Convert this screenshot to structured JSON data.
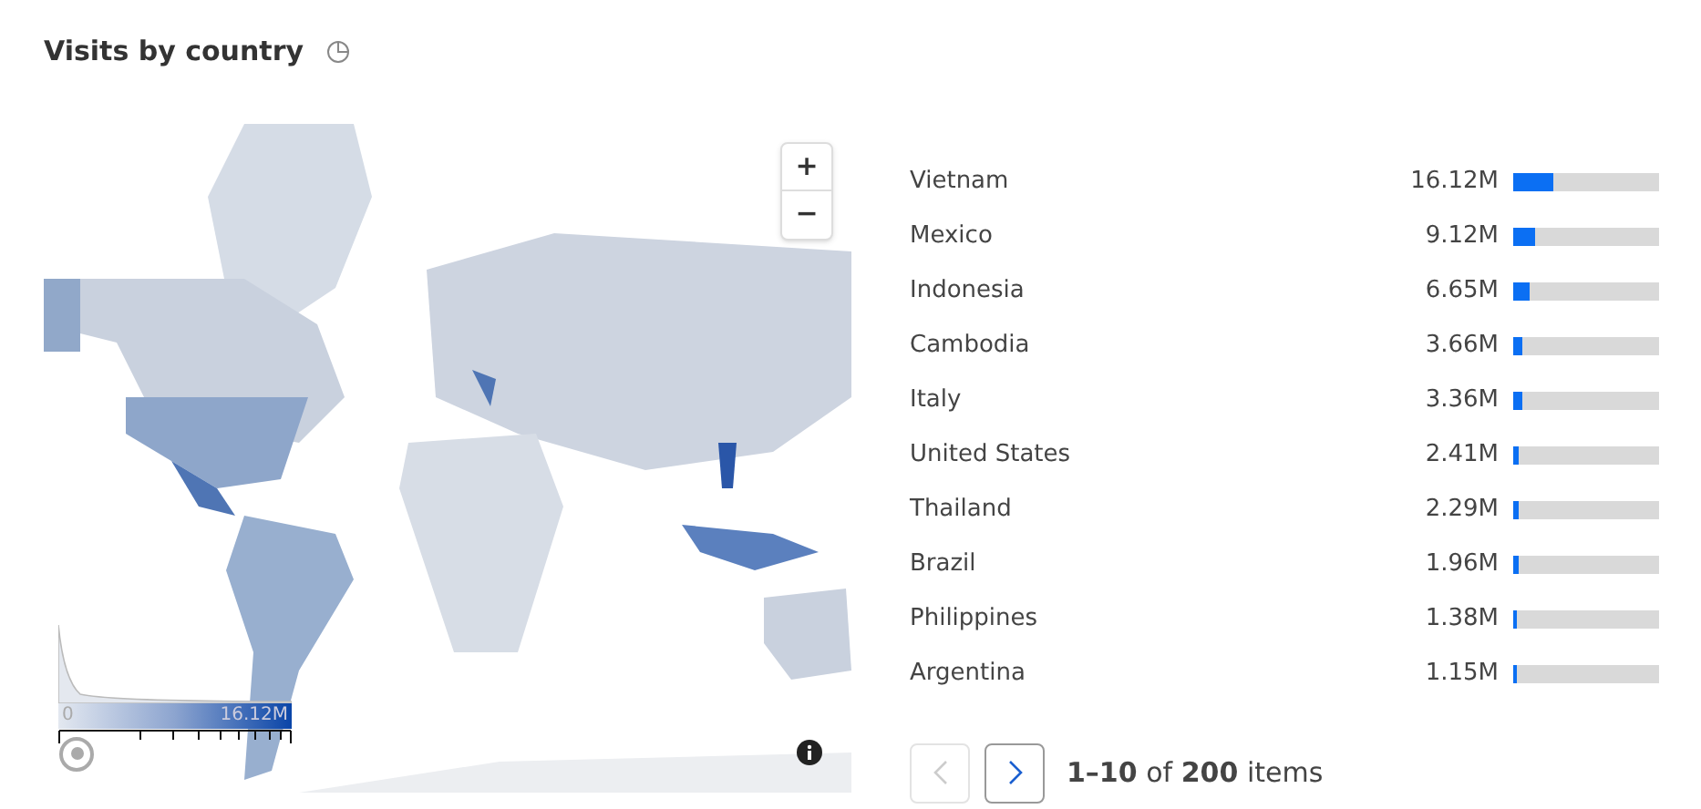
{
  "title": "Visits by country",
  "map": {
    "zoom_in": "+",
    "zoom_out": "−",
    "legend": {
      "min": "0",
      "max": "16.12M"
    }
  },
  "countries": [
    {
      "name": "Vietnam",
      "value": "16.12M",
      "level": 0.27
    },
    {
      "name": "Mexico",
      "value": "9.12M",
      "level": 0.15
    },
    {
      "name": "Indonesia",
      "value": "6.65M",
      "level": 0.11
    },
    {
      "name": "Cambodia",
      "value": "3.66M",
      "level": 0.06
    },
    {
      "name": "Italy",
      "value": "3.36M",
      "level": 0.06
    },
    {
      "name": "United States",
      "value": "2.41M",
      "level": 0.04
    },
    {
      "name": "Thailand",
      "value": "2.29M",
      "level": 0.04
    },
    {
      "name": "Brazil",
      "value": "1.96M",
      "level": 0.04
    },
    {
      "name": "Philippines",
      "value": "1.38M",
      "level": 0.025
    },
    {
      "name": "Argentina",
      "value": "1.15M",
      "level": 0.025
    }
  ],
  "pagination": {
    "prev_disabled": true,
    "next_disabled": false,
    "range": "1–10",
    "of": "of",
    "total": "200",
    "unit": "items"
  }
}
